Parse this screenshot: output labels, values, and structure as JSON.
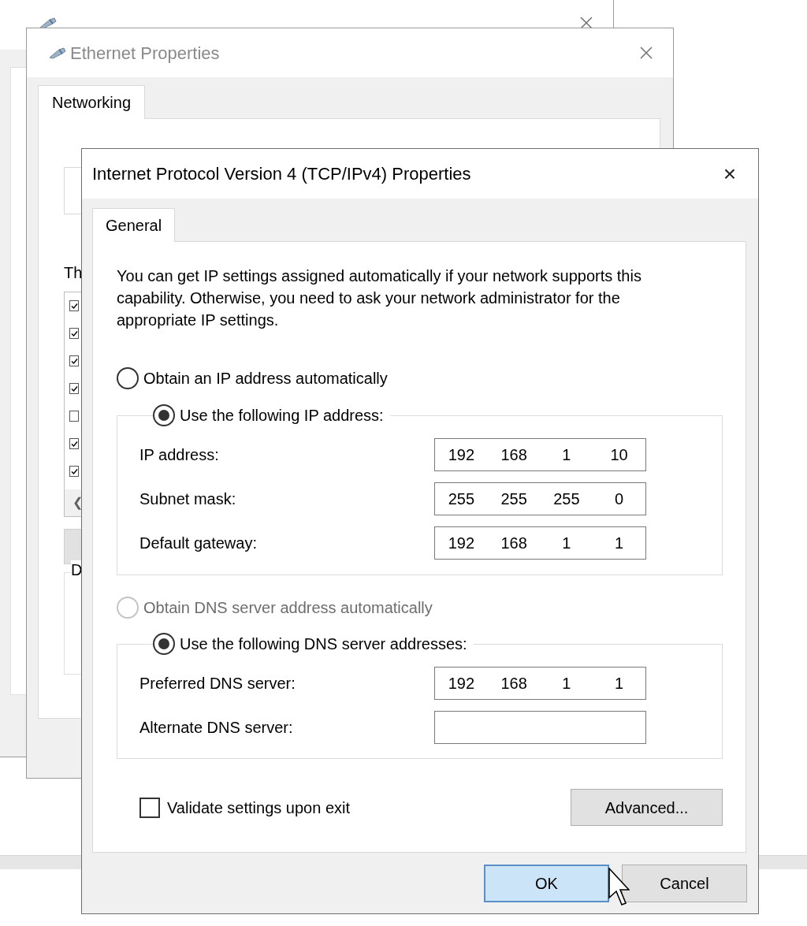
{
  "windows": [
    {
      "title": "Ethernet Properties",
      "active": false,
      "tabs": [
        {
          "label": "Networking",
          "selected": true
        }
      ],
      "items_label": "Th",
      "items": [
        {
          "checked": true
        },
        {
          "checked": true
        },
        {
          "checked": true
        },
        {
          "checked": true
        },
        {
          "checked": false
        },
        {
          "checked": true
        },
        {
          "checked": true
        }
      ],
      "scroll_arrow": "❮",
      "description_label": "D"
    }
  ],
  "dialog": {
    "title": "Internet Protocol Version 4 (TCP/IPv4) Properties",
    "close": "×",
    "tabs": [
      {
        "label": "General",
        "selected": true
      }
    ],
    "intro": "You can get IP settings assigned automatically if your network supports this capability. Otherwise, you need to ask your network administrator for the appropriate IP settings.",
    "ip_options": [
      {
        "label": "Obtain an IP address automatically",
        "selected": false,
        "disabled": false
      },
      {
        "label": "Use the following IP address:",
        "selected": true,
        "disabled": false
      }
    ],
    "ip_fields": [
      {
        "label": "IP address:",
        "octets": [
          "192",
          "168",
          "1",
          "10"
        ]
      },
      {
        "label": "Subnet mask:",
        "octets": [
          "255",
          "255",
          "255",
          "0"
        ]
      },
      {
        "label": "Default gateway:",
        "octets": [
          "192",
          "168",
          "1",
          "1"
        ]
      }
    ],
    "dns_options": [
      {
        "label": "Obtain DNS server address automatically",
        "selected": false,
        "disabled": true
      },
      {
        "label": "Use the following DNS server addresses:",
        "selected": true,
        "disabled": false
      }
    ],
    "dns_fields": [
      {
        "label": "Preferred DNS server:",
        "octets": [
          "192",
          "168",
          "1",
          "1"
        ]
      },
      {
        "label": "Alternate DNS server:"
      }
    ],
    "validate": {
      "label": "Validate settings upon exit",
      "checked": false
    },
    "advanced_button": "Advanced...",
    "buttons": [
      {
        "label": "OK",
        "default": true
      },
      {
        "label": "Cancel",
        "default": false
      }
    ]
  }
}
